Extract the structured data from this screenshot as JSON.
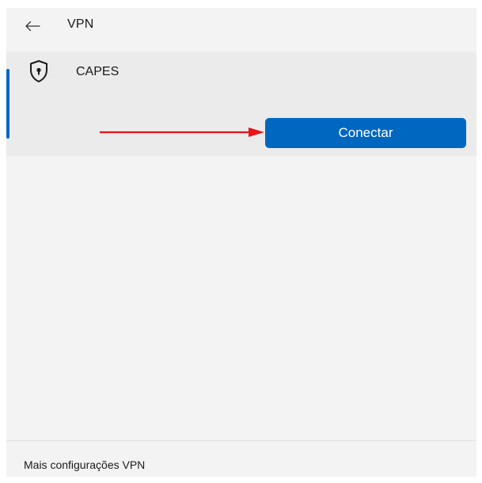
{
  "header": {
    "title": "VPN",
    "back_icon": "back-arrow-icon"
  },
  "vpn_connection": {
    "name": "CAPES",
    "icon": "shield-lock-icon",
    "connect_label": "Conectar"
  },
  "annotation": {
    "arrow_color": "#e8141b"
  },
  "footer": {
    "link_label": "Mais configurações VPN"
  },
  "colors": {
    "accent": "#0067c0",
    "background": "#f3f3f3",
    "item_background": "#ebebeb"
  }
}
